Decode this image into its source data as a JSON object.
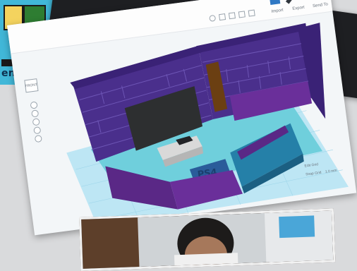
{
  "tl_card": {
    "caption": "ent!!!"
  },
  "toolbar": {
    "import_label": "Import",
    "export_label": "Export",
    "send_to_label": "Send To"
  },
  "viewport": {
    "view_cube_label": "FRONT",
    "edit_grid_label": "Edit Grid",
    "snap_grid_label": "Snap Grid",
    "snap_value": "1.0 mm"
  },
  "scene": {
    "sign_text": "PS4"
  },
  "colors": {
    "wall_purple": "#4a2f8c",
    "brick_lines": "#6d55b5",
    "sofa_teal": "#2580a8",
    "floor_teal": "#6fcfdc",
    "grid_blue": "#bde6f4"
  }
}
